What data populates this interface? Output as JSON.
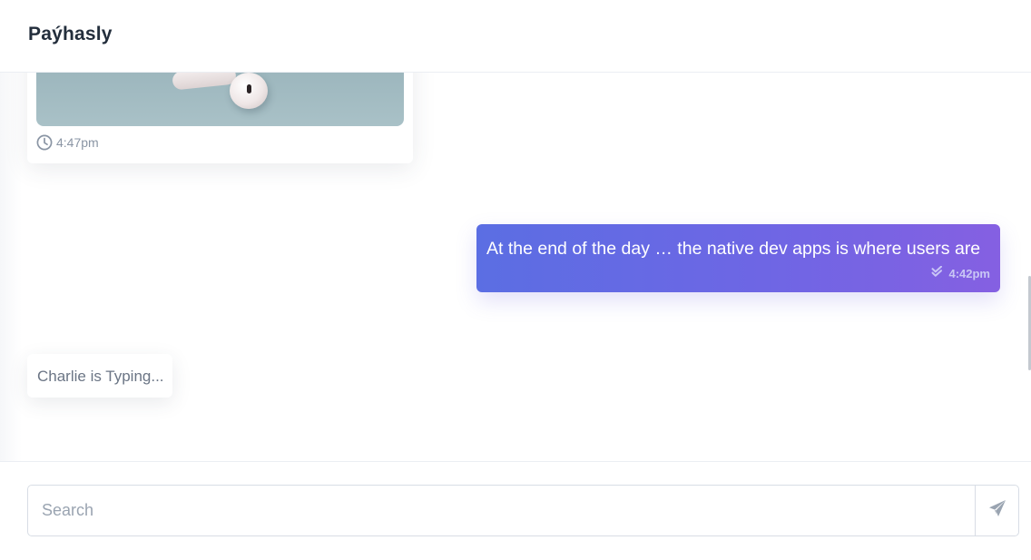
{
  "header": {
    "title": "Paýhasly"
  },
  "messages": {
    "image_message": {
      "icon": "clock-icon",
      "time": "4:47pm"
    },
    "outgoing_message": {
      "text": "At the end of the day … the native dev apps is where users are",
      "status_icon": "double-check-icon",
      "time": "4:42pm"
    },
    "typing_indicator": {
      "text": "Charlie is Typing..."
    }
  },
  "composer": {
    "placeholder": "Search",
    "value": "",
    "send_icon": "paper-plane-icon"
  },
  "colors": {
    "outgoing_gradient_start": "#5b6ee3",
    "outgoing_gradient_end": "#8560e2",
    "title": "#232e3c",
    "muted_text": "#8a95a4"
  }
}
